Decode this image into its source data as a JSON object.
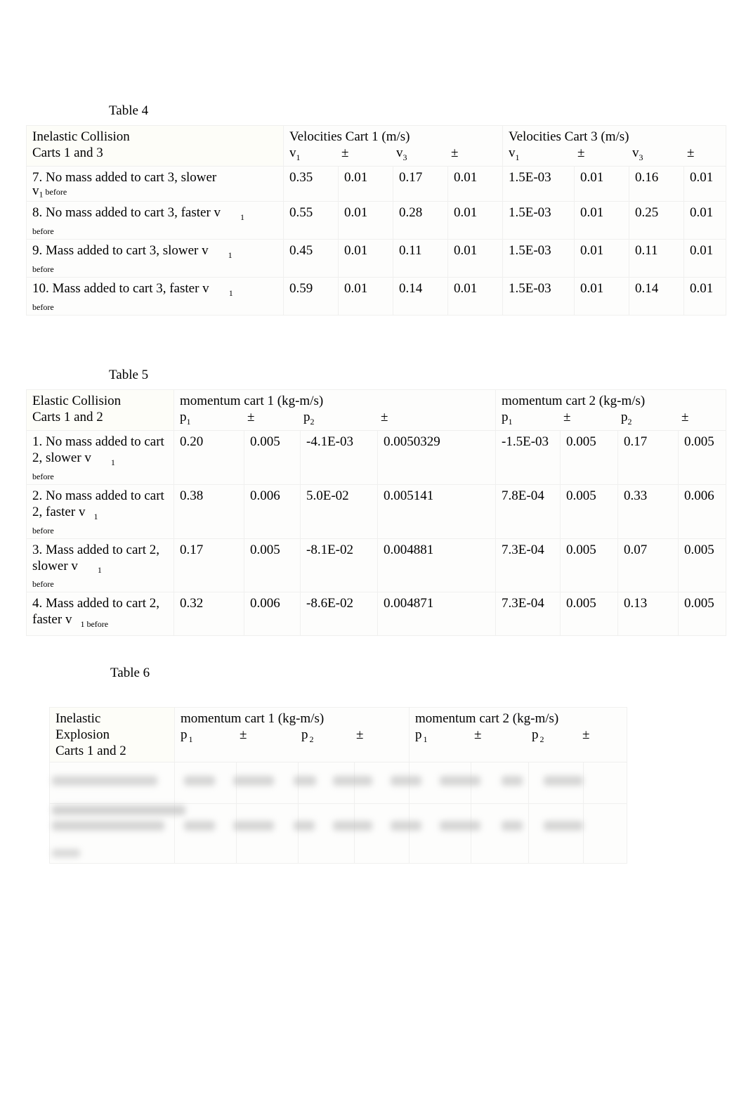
{
  "document": {
    "background_color": "#ffffff",
    "text_color": "#000000",
    "grid_color": "#f0f0ef"
  },
  "tables": [
    {
      "caption": "Table 4",
      "corner_label_line1": "Inelastic Collision",
      "corner_label_line2": "Carts 1 and 3",
      "group_headers": [
        "Velocities Cart 1 (m/s)",
        "Velocities Cart 3 (m/s)"
      ],
      "column_headers": [
        "v1",
        "±",
        "v3",
        "±",
        "v1",
        "±",
        "v3",
        "±"
      ],
      "column_header_parts": [
        {
          "base": "v",
          "sub": "1"
        },
        {
          "base": "±",
          "sub": ""
        },
        {
          "base": "v",
          "sub": "3"
        },
        {
          "base": "±",
          "sub": ""
        },
        {
          "base": "v",
          "sub": "1"
        },
        {
          "base": "±",
          "sub": ""
        },
        {
          "base": "v",
          "sub": "3"
        },
        {
          "base": "±",
          "sub": ""
        }
      ],
      "rows": [
        {
          "label_main": "7. No mass added to cart 3, slower",
          "label_trailing_sub": "",
          "label_second_line": "v",
          "label_second_line_sub": "1",
          "label_second_line_word": "before",
          "values": [
            "0.35",
            "0.01",
            "0.17",
            "0.01",
            "1.5E-03",
            "0.01",
            "0.16",
            "0.01"
          ]
        },
        {
          "label_main": "8. No mass added to cart 3, faster v",
          "label_trailing_sub": "1",
          "label_second_line": "",
          "label_second_line_sub": "",
          "label_second_line_word": "before",
          "values": [
            "0.55",
            "0.01",
            "0.28",
            "0.01",
            "1.5E-03",
            "0.01",
            "0.25",
            "0.01"
          ]
        },
        {
          "label_main": "9. Mass added to cart 3, slower v",
          "label_trailing_sub": "1",
          "label_second_line": "",
          "label_second_line_sub": "",
          "label_second_line_word": "before",
          "values": [
            "0.45",
            "0.01",
            "0.11",
            "0.01",
            "1.5E-03",
            "0.01",
            "0.11",
            "0.01"
          ]
        },
        {
          "label_main": "10. Mass added to cart 3, faster v",
          "label_trailing_sub": "1",
          "label_second_line": "",
          "label_second_line_sub": "",
          "label_second_line_word": "before",
          "values": [
            "0.59",
            "0.01",
            "0.14",
            "0.01",
            "1.5E-03",
            "0.01",
            "0.14",
            "0.01"
          ]
        }
      ]
    },
    {
      "caption": "Table 5",
      "corner_label_line1": "Elastic Collision",
      "corner_label_line2": "Carts 1 and 2",
      "group_headers": [
        "momentum cart 1 (kg-m/s)",
        "momentum cart 2 (kg-m/s)"
      ],
      "column_header_parts": [
        {
          "base": "p",
          "sub": "1"
        },
        {
          "base": "±",
          "sub": ""
        },
        {
          "base": "p",
          "sub": "2"
        },
        {
          "base": "±",
          "sub": ""
        },
        {
          "base": "p",
          "sub": "1"
        },
        {
          "base": "±",
          "sub": ""
        },
        {
          "base": "p",
          "sub": "2"
        },
        {
          "base": "±",
          "sub": ""
        }
      ],
      "rows": [
        {
          "label_main": "1. No mass added to cart 2, slower v",
          "label_trailing_sub": "1",
          "label_second_line_word": "before",
          "values": [
            "0.20",
            "0.005",
            "-4.1E-03",
            "0.0050329",
            "-1.5E-03",
            "0.005",
            "0.17",
            "0.005"
          ]
        },
        {
          "label_main": "2. No mass added to cart 2, faster v",
          "label_trailing_sub": "1",
          "label_second_line_word": "before",
          "values": [
            "0.38",
            "0.006",
            "5.0E-02",
            "0.005141",
            "7.8E-04",
            "0.005",
            "0.33",
            "0.006"
          ]
        },
        {
          "label_main": "3. Mass added to cart 2, slower v",
          "label_trailing_sub": "1",
          "label_second_line_word": "before",
          "values": [
            "0.17",
            "0.005",
            "-8.1E-02",
            "0.004881",
            "7.3E-04",
            "0.005",
            "0.07",
            "0.005"
          ]
        },
        {
          "label_main": "4. Mass added to cart 2, faster v",
          "label_trailing_sub": "1",
          "label_second_line_word": "before",
          "label_inline_before": "before",
          "values": [
            "0.32",
            "0.006",
            "-8.6E-02",
            "0.004871",
            "7.3E-04",
            "0.005",
            "0.13",
            "0.005"
          ]
        }
      ]
    },
    {
      "caption": "Table 6",
      "corner_label_line1": "Inelastic",
      "corner_label_line2": "Explosion",
      "corner_label_line3": "Carts 1 and 2",
      "group_headers": [
        "momentum cart 1 (kg-m/s)",
        "momentum cart 2 (kg-m/s)"
      ],
      "column_header_parts": [
        {
          "base": "p",
          "sub": "1"
        },
        {
          "base": "±",
          "sub": ""
        },
        {
          "base": "p",
          "sub": "2"
        },
        {
          "base": "±",
          "sub": ""
        },
        {
          "base": "p",
          "sub": "1"
        },
        {
          "base": "±",
          "sub": ""
        },
        {
          "base": "p",
          "sub": "2"
        },
        {
          "base": "±",
          "sub": ""
        }
      ],
      "body_state": "blurred-illegible",
      "rows": [
        {
          "label_main": "",
          "values": [
            "",
            "",
            "",
            "",
            "",
            "",
            "",
            ""
          ]
        },
        {
          "label_main": "",
          "values": [
            "",
            "",
            "",
            "",
            "",
            "",
            "",
            ""
          ]
        }
      ]
    }
  ]
}
